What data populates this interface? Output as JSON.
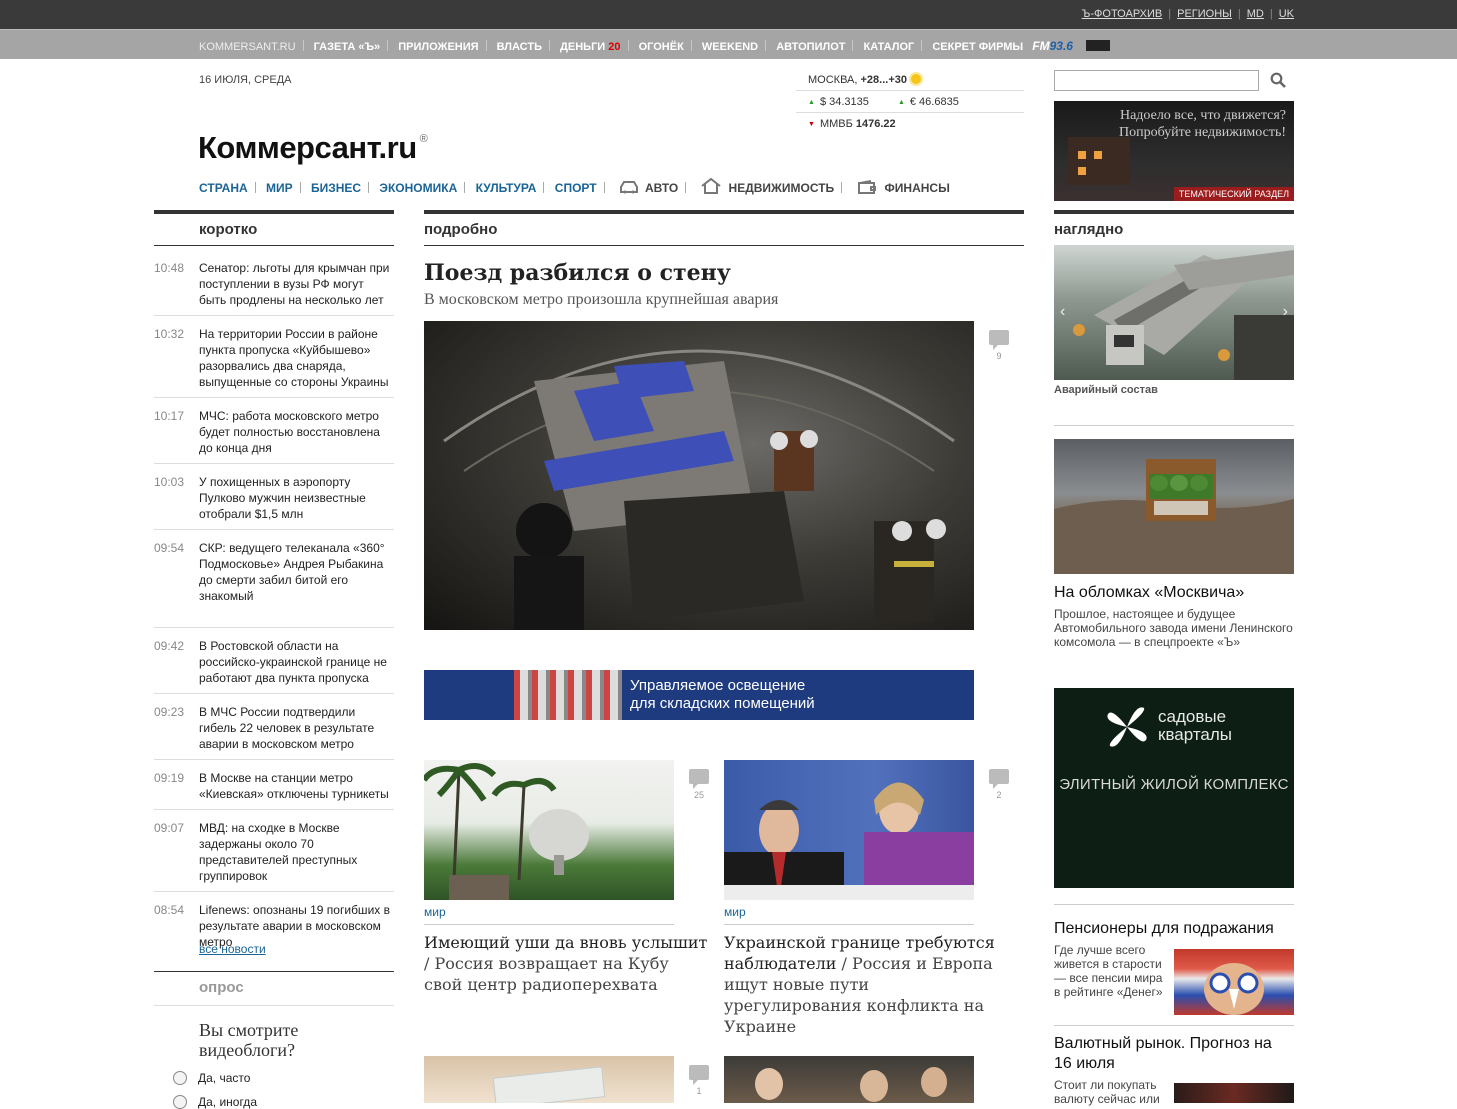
{
  "top_links": [
    "Ъ-ФОТОАРХИВ",
    "РЕГИОНЫ",
    "MD",
    "UK"
  ],
  "nav": {
    "site": "KOMMERSANT.RU",
    "items": [
      "ГАЗЕТА «Ъ»",
      "ПРИЛОЖЕНИЯ",
      "ВЛАСТЬ",
      "ДЕНЬГИ",
      "ОГОНЁК",
      "WEEKEND",
      "АВТОПИЛОТ",
      "КАТАЛОГ",
      "СЕКРЕТ ФИРМЫ"
    ],
    "money_badge": "20",
    "fm_label": "FM",
    "fm_freq": "93.6"
  },
  "header": {
    "date": "16 ИЮЛЯ, СРЕДА",
    "weather_city": "МОСКВА,",
    "weather_temp": "+28...+30",
    "usd": "$ 34.3135",
    "eur": "€ 46.6835",
    "micex_label": "ММВБ",
    "micex_value": "1476.22",
    "logo": "Коммерсант.ru",
    "logo_mark": "®"
  },
  "sections": [
    "СТРАНА",
    "МИР",
    "БИЗНЕС",
    "ЭКОНОМИКА",
    "КУЛЬТУРА",
    "СПОРТ"
  ],
  "sections_icons": {
    "auto": "АВТО",
    "realty": "НЕДВИЖИМОСТЬ",
    "finance": "ФИНАНСЫ"
  },
  "ad_top": {
    "line1": "Надоело все, что движется?",
    "line2": "Попробуйте недвижимость!",
    "banner": "ТЕМАТИЧЕСКИЙ РАЗДЕЛ"
  },
  "columns": {
    "left": "коротко",
    "main": "подробно",
    "right": "наглядно"
  },
  "news": [
    {
      "time": "10:48",
      "text": "Сенатор: льготы для крымчан при поступлении в вузы РФ могут быть продлены на несколько лет"
    },
    {
      "time": "10:32",
      "text": "На территории России в районе пункта пропуска «Куйбышево» разорвались два снаряда, выпущенные со стороны Украины"
    },
    {
      "time": "10:17",
      "text": "МЧС: работа московского метро будет полностью восстановлена до конца дня"
    },
    {
      "time": "10:03",
      "text": "У похищенных в аэропорту Пулково мужчин неизвестные отобрали $1,5 млн"
    },
    {
      "time": "09:54",
      "text": "СКР: ведущего телеканала «360° Подмосковье» Андрея Рыбакина до смерти забил битой его знакомый"
    },
    {
      "time": "09:42",
      "text": "В Ростовской области на российско-украинской границе не работают два пункта пропуска"
    },
    {
      "time": "09:23",
      "text": "В МЧС России подтвердили гибель 22 человек в результате аварии в московском метро"
    },
    {
      "time": "09:19",
      "text": "В Москве на станции метро «Киевская» отключены турникеты"
    },
    {
      "time": "09:07",
      "text": "МВД: на сходке в Москве задержаны около 70 представителей преступных группировок"
    },
    {
      "time": "08:54",
      "text": "Lifenews: опознаны 19 погибших в результате аварии в московском метро"
    }
  ],
  "all_news": "все новости",
  "poll": {
    "head": "опрос",
    "question": "Вы смотрите видеоблоги?",
    "options": [
      "Да, часто",
      "Да, иногда"
    ]
  },
  "main_story": {
    "title": "Поезд разбился о стену",
    "subtitle": "В московском метро произошла крупнейшая авария",
    "comments": "9"
  },
  "ad_light": {
    "line1": "Управляемое освещение",
    "line2": "для складских помещений"
  },
  "stories": [
    {
      "category": "мир",
      "title": "Имеющий уши да вновь услышит",
      "lead": "Россия возвращает на Кубу свой центр радиоперехвата",
      "comments": "25"
    },
    {
      "category": "мир",
      "title": "Украинской границе требуются наблюдатели",
      "lead": "Россия и Европа ищут новые пути урегулирования конфликта на Украине",
      "comments": "2"
    }
  ],
  "bottom_comments": "1",
  "story_sep": " / ",
  "right": {
    "caption1": "Аварийный состав",
    "title2": "На обломках «Москвича»",
    "text2": "Прошлое, настоящее и будущее Автомобильного завода имени Ленинского комсомола — в спецпроекте «Ъ»",
    "ad_garden_1": "садовые",
    "ad_garden_2": "кварталы",
    "ad_garden_3": "ЭЛИТНЫЙ ЖИЛОЙ КОМПЛЕКС",
    "title3": "Пенсионеры для подражания",
    "text3": "Где лучше всего живется в старости — все пенсии мира в рейтинге «Денег»",
    "title4": "Валютный рынок. Прогноз на 16 июля",
    "text4": "Стоит ли покупать валюту сейчас или"
  },
  "colors": {
    "link": "#1a6496",
    "accent_red": "#d00000"
  }
}
